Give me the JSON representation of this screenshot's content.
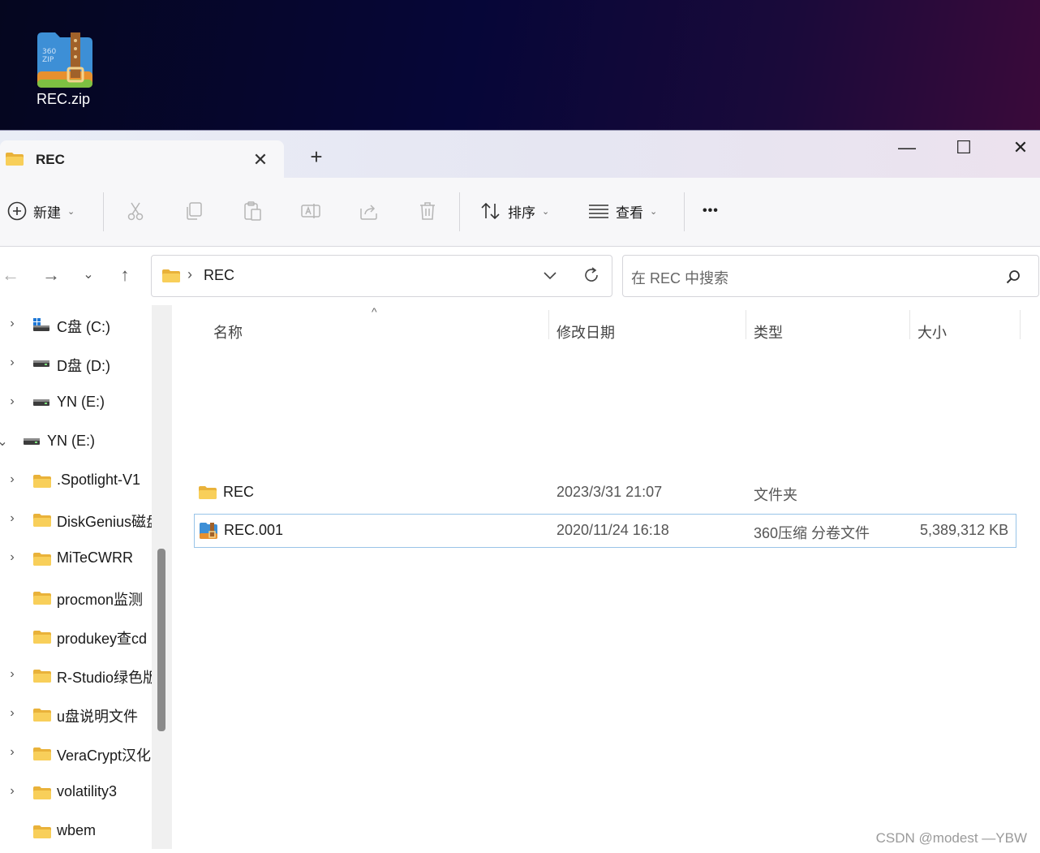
{
  "desktop": {
    "icon_label": "REC.zip",
    "icon_badge": "360\nZIP"
  },
  "tab": {
    "title": "REC"
  },
  "window_controls": {
    "minimize": "—",
    "maximize": "☐",
    "close": "✕"
  },
  "toolbar": {
    "new_label": "新建",
    "sort_label": "排序",
    "view_label": "查看",
    "more_label": "•••"
  },
  "address": {
    "crumb_sep": "›",
    "path": "REC"
  },
  "search": {
    "placeholder": "在 REC 中搜索"
  },
  "sidebar": {
    "items": [
      {
        "label": "C盘 (C:)",
        "type": "drive-c",
        "arrow": "›"
      },
      {
        "label": "D盘 (D:)",
        "type": "drive",
        "arrow": "›"
      },
      {
        "label": "YN (E:)",
        "type": "drive",
        "arrow": "›"
      },
      {
        "label": "YN (E:)",
        "type": "drive",
        "arrow": "⌄",
        "expanded": true
      },
      {
        "label": ".Spotlight-V1",
        "type": "folder",
        "arrow": "›"
      },
      {
        "label": "DiskGenius磁盘",
        "type": "folder",
        "arrow": "›"
      },
      {
        "label": "MiTeCWRR",
        "type": "folder",
        "arrow": "›"
      },
      {
        "label": "procmon监测",
        "type": "folder",
        "arrow": ""
      },
      {
        "label": "produkey查cd",
        "type": "folder",
        "arrow": ""
      },
      {
        "label": "R-Studio绿色版",
        "type": "folder",
        "arrow": "›"
      },
      {
        "label": "u盘说明文件",
        "type": "folder",
        "arrow": "›"
      },
      {
        "label": "VeraCrypt汉化",
        "type": "folder",
        "arrow": "›"
      },
      {
        "label": "volatility3",
        "type": "folder",
        "arrow": "›"
      },
      {
        "label": "wbem",
        "type": "folder",
        "arrow": ""
      }
    ]
  },
  "columns": {
    "name": "名称",
    "modified": "修改日期",
    "type": "类型",
    "size": "大小",
    "sort_indicator": "^"
  },
  "files": [
    {
      "name": "REC",
      "modified": "2023/3/31 21:07",
      "type": "文件夹",
      "size": "",
      "icon": "folder-icon"
    },
    {
      "name": "REC.001",
      "modified": "2020/11/24 16:18",
      "type": "360压缩 分卷文件",
      "size": "5,389,312 KB",
      "icon": "archive-icon",
      "selected": true
    }
  ],
  "watermark": "CSDN @modest —YBW",
  "colors": {
    "accent": "#0067c0",
    "folder": "#f5c342",
    "selection_border": "#99c4e8"
  }
}
